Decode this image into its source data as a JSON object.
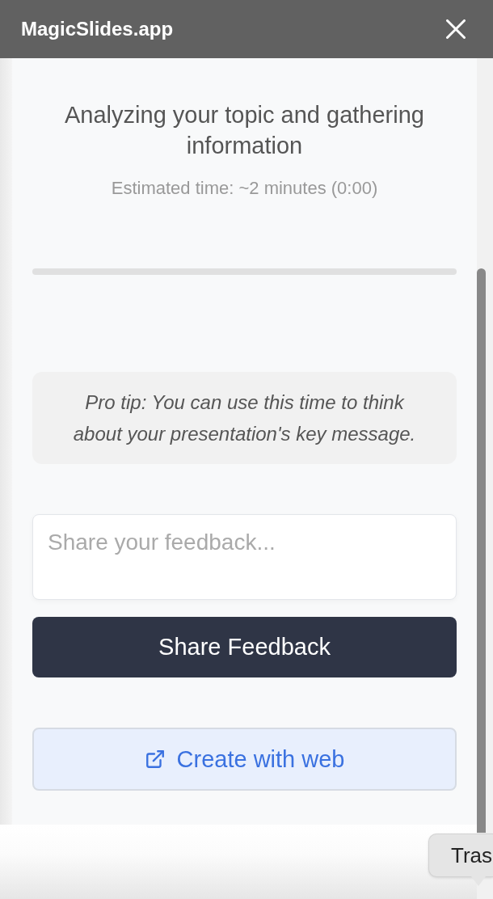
{
  "title_bar": {
    "title": "MagicSlides.app"
  },
  "status": {
    "message": "Analyzing your topic and gathering information",
    "estimate": "Estimated time: ~2 minutes (0:00)"
  },
  "tip": {
    "text": "Pro tip: You can use this time to think about your presentation's key message."
  },
  "feedback": {
    "placeholder": "Share your feedback...",
    "button": "Share Feedback"
  },
  "web_button": {
    "label": "Create with web"
  },
  "tooltip": {
    "text": "Tras"
  }
}
